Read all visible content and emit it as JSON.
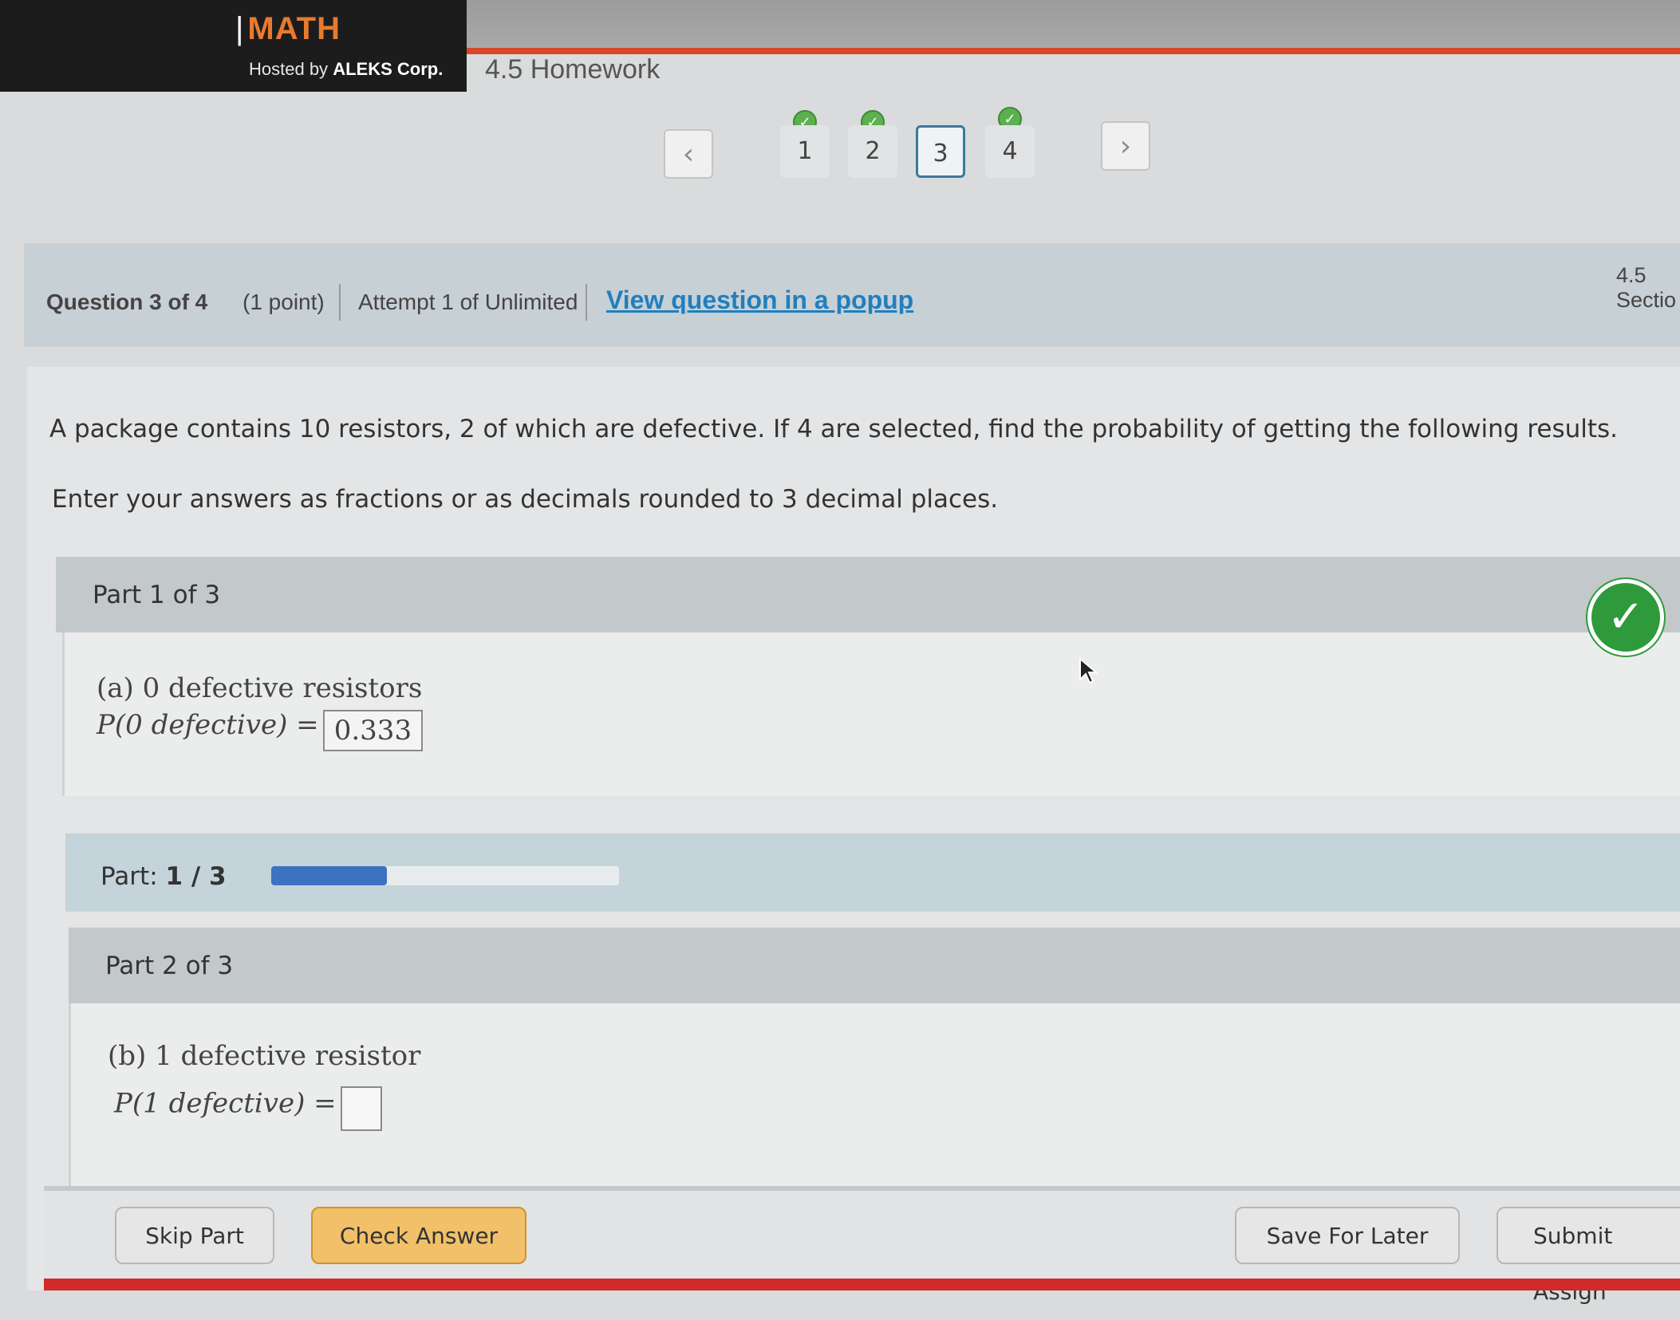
{
  "header": {
    "brand": "MATH",
    "hosted_by_prefix": "Hosted by",
    "hosted_by_company": "ALEKS Corp.",
    "assignment_title": "4.5 Homework",
    "section_label": "4.5 Sectio"
  },
  "question_nav": {
    "prev_icon": "chevron-left-icon",
    "next_icon": "chevron-right-icon",
    "items": [
      {
        "label": "1",
        "completed": true,
        "current": false
      },
      {
        "label": "2",
        "completed": true,
        "current": false
      },
      {
        "label": "3",
        "completed": false,
        "current": true
      },
      {
        "label": "4",
        "completed": true,
        "current": false
      }
    ]
  },
  "question_bar": {
    "question": "Question 3 of 4",
    "points": "(1 point)",
    "attempt": "Attempt 1 of Unlimited",
    "popup_link": "View question in a popup"
  },
  "problem": {
    "stem": "A package contains 10 resistors, 2 of which are defective. If 4 are selected, find the probability of getting the following results.",
    "instructions": "Enter your answers as fractions or as decimals rounded to 3 decimal places."
  },
  "part1": {
    "header": "Part 1 of 3",
    "label": "(a) 0 defective resistors",
    "expression": "P(0 defective) =",
    "answer": "0.333",
    "status": "correct"
  },
  "progress": {
    "label": "Part:",
    "value": "1 / 3",
    "fraction": 0.333
  },
  "part2": {
    "header": "Part 2 of 3",
    "label": "(b) 1 defective resistor",
    "expression": "P(1 defective) =",
    "answer": ""
  },
  "footer": {
    "skip": "Skip Part",
    "check": "Check Answer",
    "save": "Save For Later",
    "submit": "Submit Assign"
  },
  "colors": {
    "accent_orange": "#e87a2e",
    "link_blue": "#1f7fbf",
    "progress_blue": "#3d72c2",
    "correct_green": "#2f9a3c",
    "footer_red": "#cf2c2a"
  }
}
